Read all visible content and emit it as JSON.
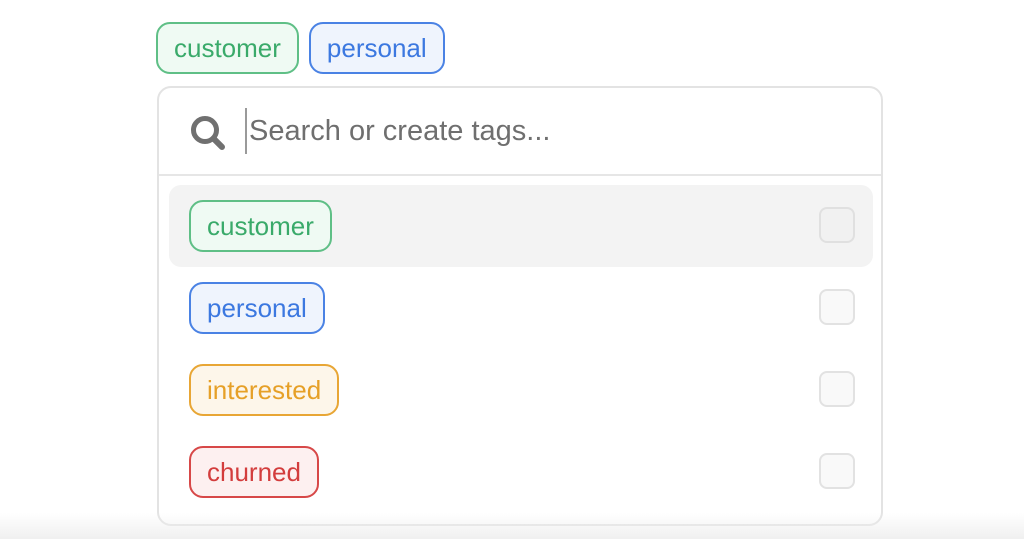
{
  "selected_tags": [
    {
      "label": "customer",
      "color": "green"
    },
    {
      "label": "personal",
      "color": "blue"
    }
  ],
  "search": {
    "placeholder": "Search or create tags...",
    "value": "",
    "icon": "search-icon"
  },
  "options": [
    {
      "label": "customer",
      "color": "green",
      "checked": false,
      "hovered": true
    },
    {
      "label": "personal",
      "color": "blue",
      "checked": false,
      "hovered": false
    },
    {
      "label": "interested",
      "color": "orange",
      "checked": false,
      "hovered": false
    },
    {
      "label": "churned",
      "color": "red",
      "checked": false,
      "hovered": false
    }
  ],
  "colors": {
    "green": "#3aaa6a",
    "blue": "#3c78e0",
    "orange": "#e6a027",
    "red": "#d33d3d"
  }
}
